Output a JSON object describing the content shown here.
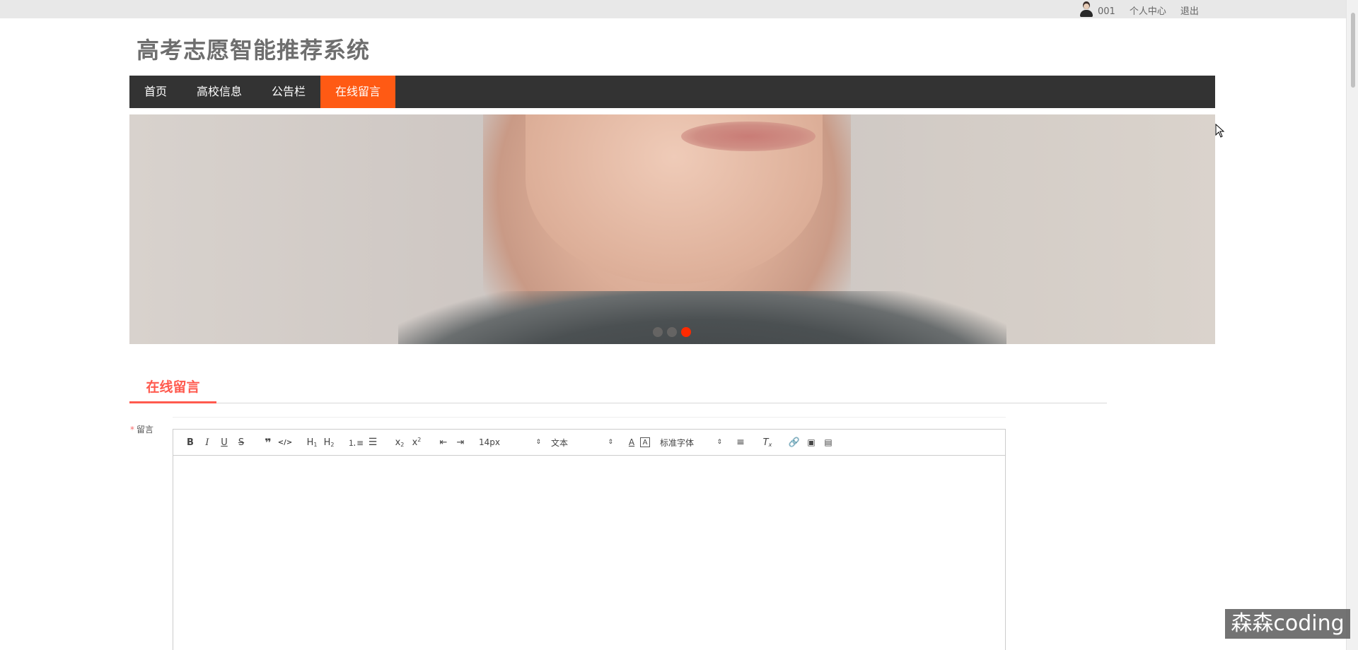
{
  "topbar": {
    "user_id": "001",
    "personal_center": "个人中心",
    "logout": "退出"
  },
  "site": {
    "title": "高考志愿智能推荐系统"
  },
  "nav": {
    "items": [
      {
        "label": "首页"
      },
      {
        "label": "高校信息"
      },
      {
        "label": "公告栏"
      },
      {
        "label": "在线留言"
      }
    ],
    "active_index": 3
  },
  "carousel": {
    "slide_count": 3,
    "active_slide": 3
  },
  "section": {
    "tab_label": "在线留言"
  },
  "form": {
    "message_label": "留言",
    "required_mark": "*",
    "editor": {
      "font_size": "14px",
      "header": "文本",
      "font_family": "标准字体",
      "content": ""
    }
  },
  "colors": {
    "accent": "#ff5a14",
    "tab_accent": "#ff5a4e",
    "nav_bg": "#333333",
    "carousel_active": "#ff2a00"
  },
  "watermark": "森森coding"
}
